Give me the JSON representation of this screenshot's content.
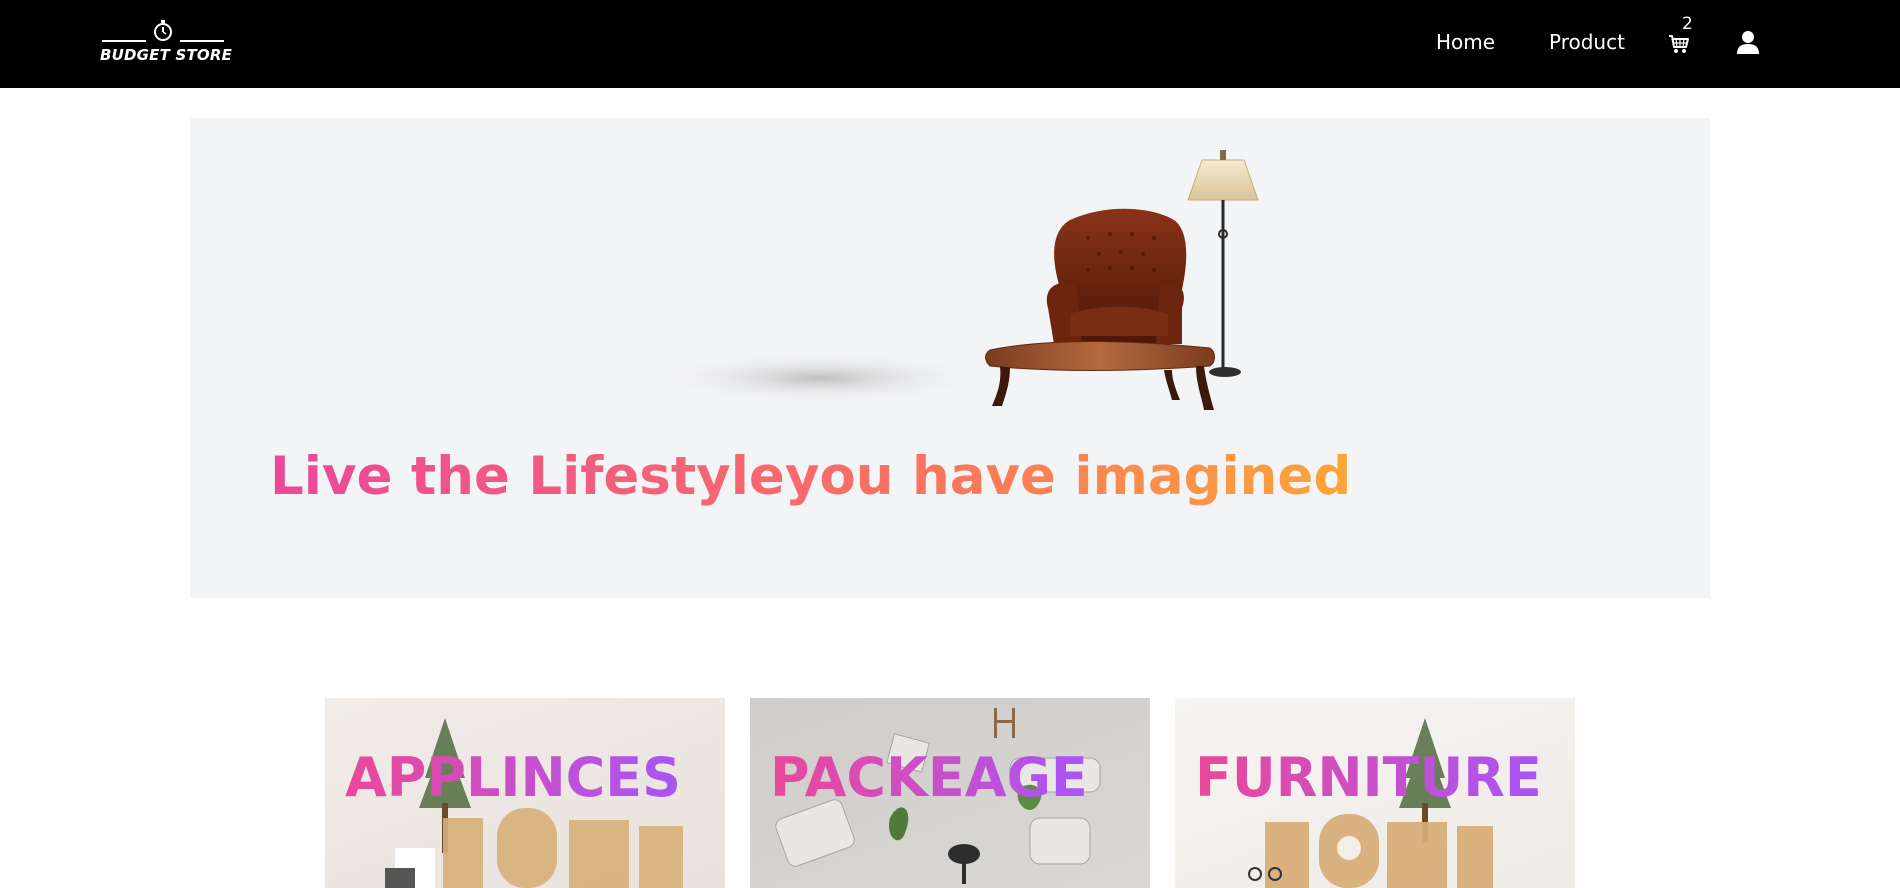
{
  "brand": {
    "name": "BUDGET STORE",
    "logo_icon": "stopwatch-icon"
  },
  "nav": {
    "home_label": "Home",
    "product_label": "Product",
    "cart_count": "2",
    "cart_icon": "shopping-cart-icon",
    "user_icon": "user-icon"
  },
  "hero": {
    "heading": "Live the Lifestyleyou have imagined",
    "gradient": [
      "#ec4899",
      "#f97360",
      "#fbbf24"
    ],
    "image": "armchair-coffee-table-floor-lamp"
  },
  "categories": [
    {
      "title": "APPLINCES",
      "image": "home-letters-with-furniture"
    },
    {
      "title": "PACKEAGE",
      "image": "floating-furniture-collection"
    },
    {
      "title": "FURNITURE",
      "image": "home-letters-with-furniture"
    }
  ],
  "colors": {
    "navbar_bg": "#000000",
    "hero_bg": "#f3f4f6",
    "category_gradient": [
      "#ec4899",
      "#a855f7"
    ]
  }
}
